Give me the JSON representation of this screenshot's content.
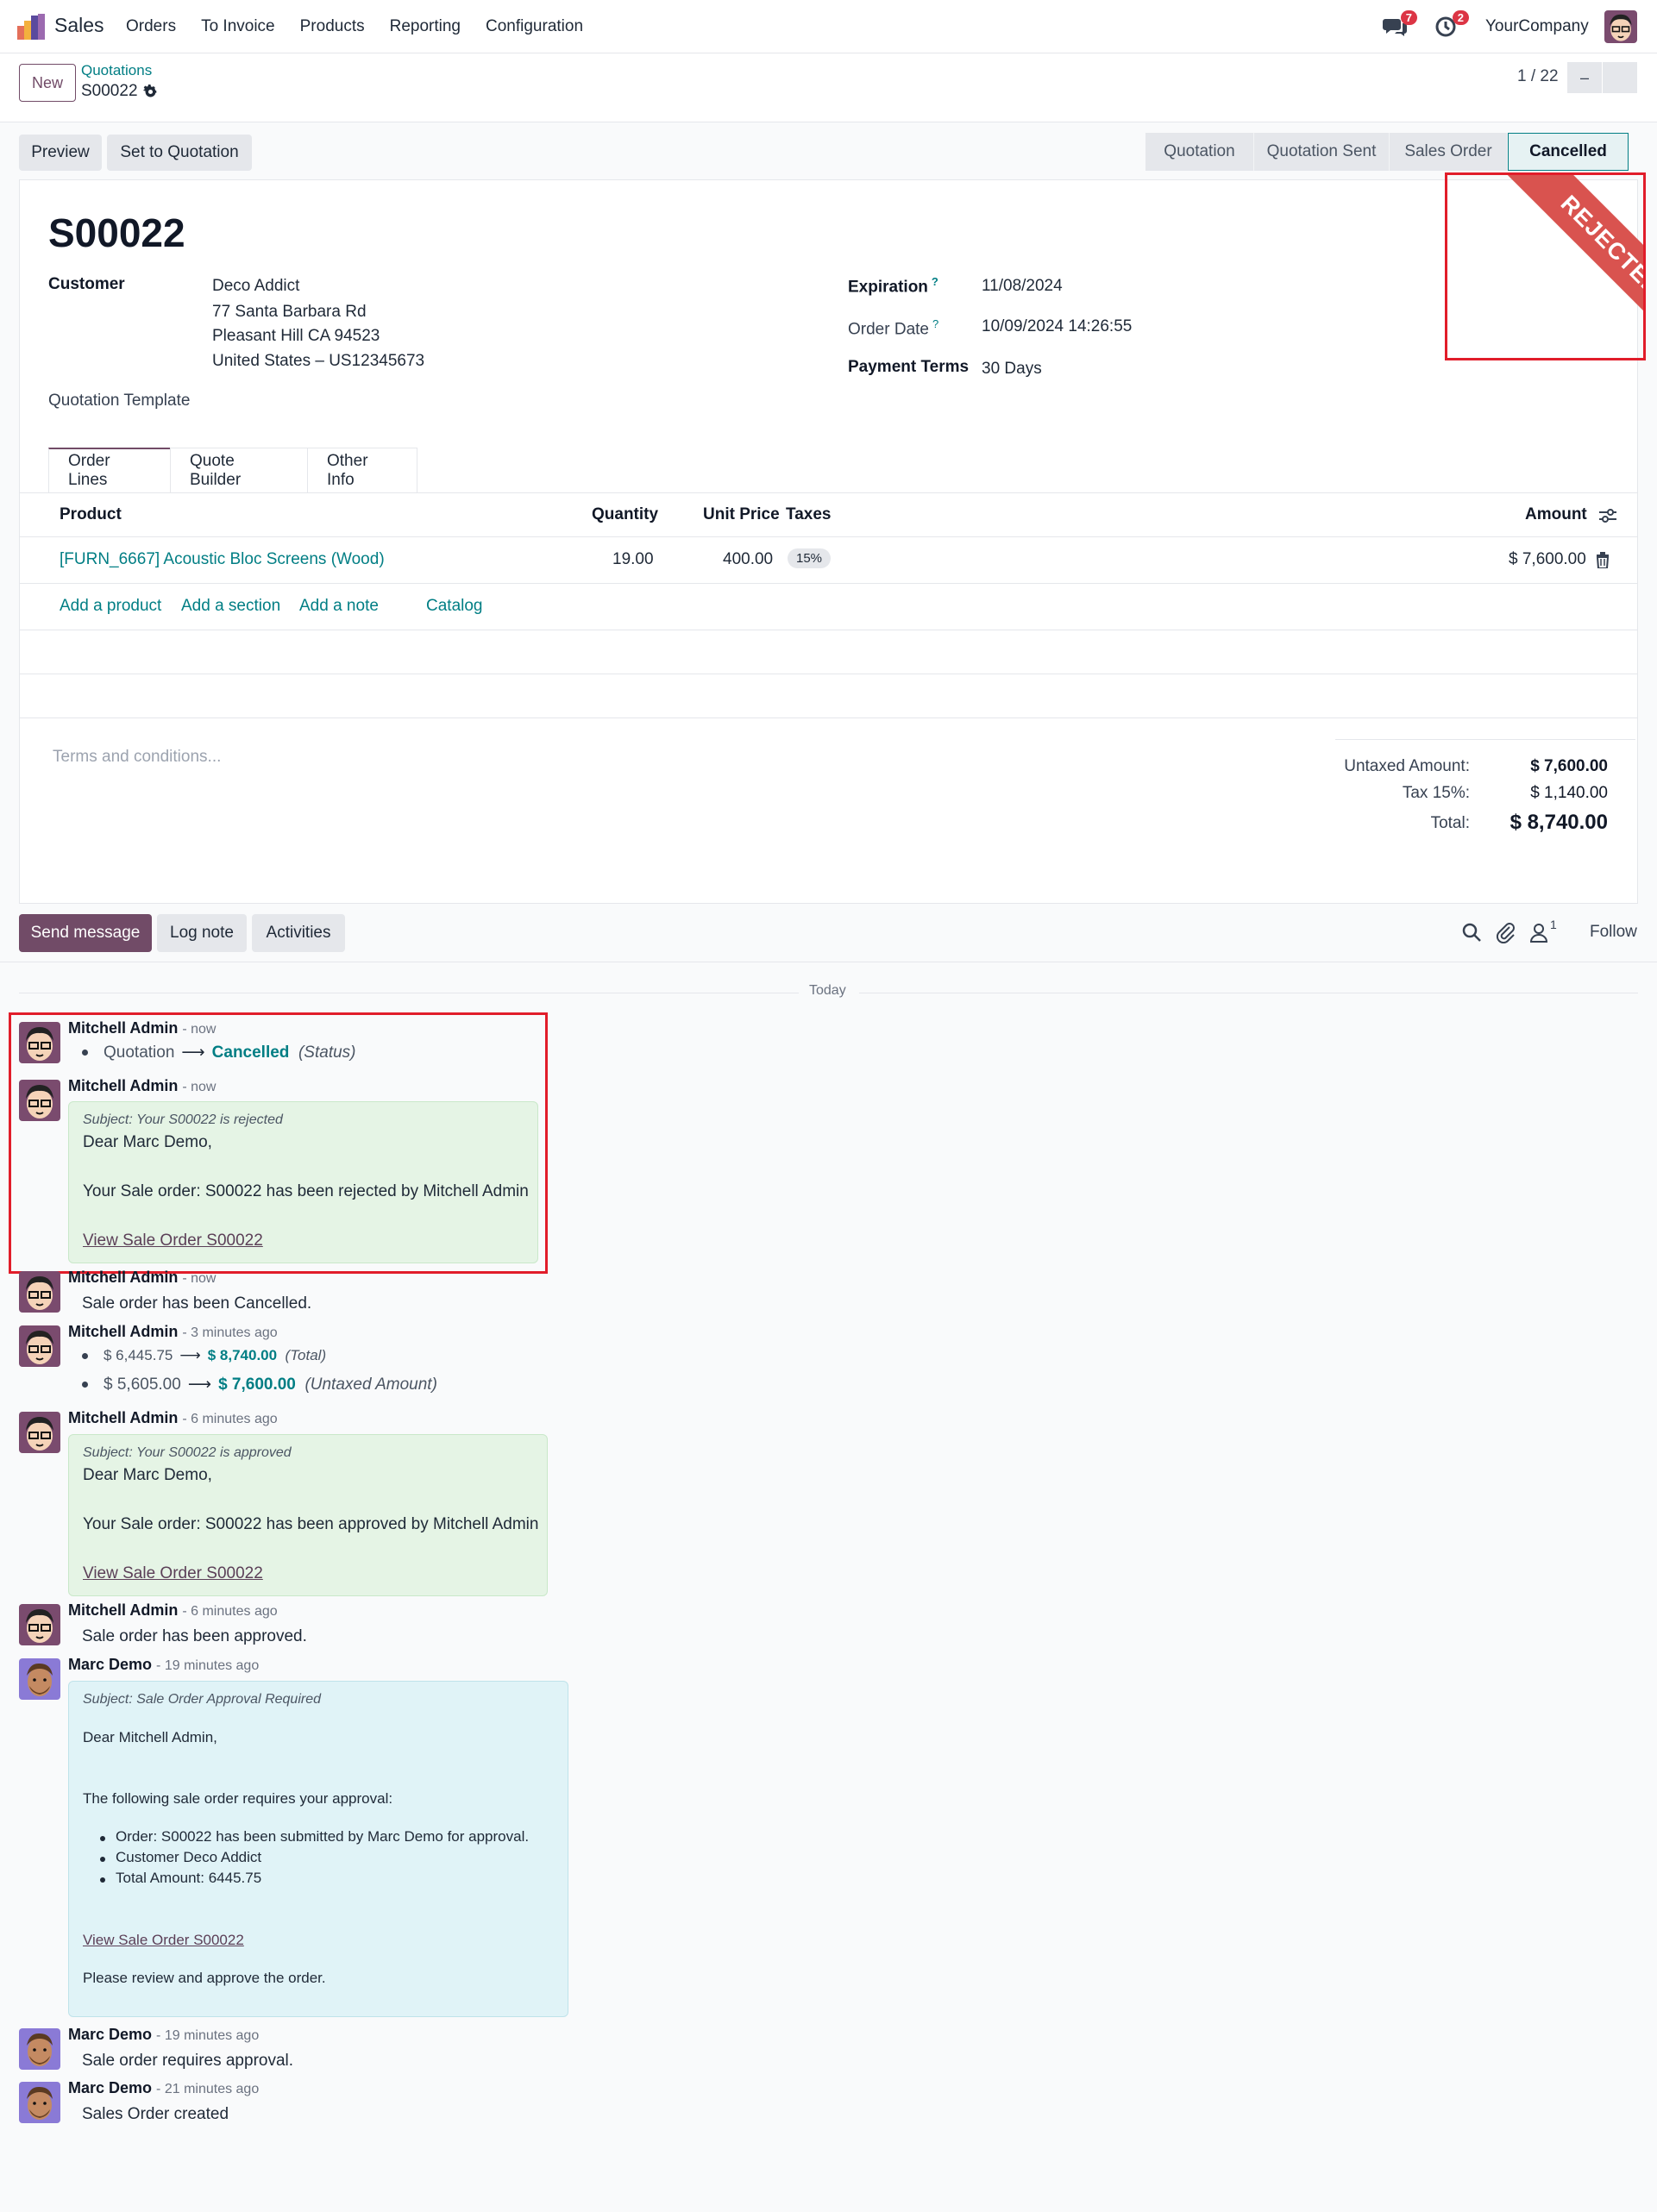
{
  "navbar": {
    "app_name": "Sales",
    "menu": [
      "Orders",
      "To Invoice",
      "Products",
      "Reporting",
      "Configuration"
    ],
    "messages_badge": "7",
    "activities_badge": "2",
    "company": "YourCompany"
  },
  "control": {
    "new_label": "New",
    "breadcrumb_parent": "Quotations",
    "breadcrumb_current": "S00022",
    "pager": "1 / 22"
  },
  "actions": {
    "preview": "Preview",
    "set_to_quotation": "Set to Quotation"
  },
  "statusbar": {
    "steps": [
      "Quotation",
      "Quotation Sent",
      "Sales Order",
      "Cancelled"
    ],
    "active": "Cancelled"
  },
  "form": {
    "name": "S00022",
    "ribbon": "REJECTED",
    "customer_label": "Customer",
    "customer_name": "Deco Addict",
    "address_line1": "77 Santa Barbara Rd",
    "address_line2": "Pleasant Hill CA 94523",
    "address_line3": "United States – US12345673",
    "quotation_template_label": "Quotation Template",
    "expiration_label": "Expiration",
    "expiration_value": "11/08/2024",
    "order_date_label": "Order Date",
    "order_date_value": "10/09/2024 14:26:55",
    "payment_terms_label": "Payment Terms",
    "payment_terms_value": "30 Days",
    "help_mark": "?"
  },
  "tabs": [
    "Order Lines",
    "Quote Builder",
    "Other Info"
  ],
  "order_lines": {
    "headers": {
      "product": "Product",
      "quantity": "Quantity",
      "unit_price": "Unit Price",
      "taxes": "Taxes",
      "amount": "Amount"
    },
    "rows": [
      {
        "product": "[FURN_6667] Acoustic Bloc Screens (Wood)",
        "quantity": "19.00",
        "unit_price": "400.00",
        "tax": "15%",
        "amount": "$ 7,600.00"
      }
    ],
    "add_product": "Add a product",
    "add_section": "Add a section",
    "add_note": "Add a note",
    "catalog": "Catalog"
  },
  "terms_placeholder": "Terms and conditions...",
  "totals": {
    "untaxed_label": "Untaxed Amount:",
    "untaxed_value": "$ 7,600.00",
    "tax_label": "Tax 15%:",
    "tax_value": "$ 1,140.00",
    "total_label": "Total:",
    "total_value": "$ 8,740.00"
  },
  "chatter": {
    "send_message": "Send message",
    "log_note": "Log note",
    "activities": "Activities",
    "followers_count": "1",
    "follow": "Follow",
    "today": "Today",
    "messages": [
      {
        "author": "Mitchell Admin",
        "time": "- now",
        "old": "Quotation",
        "new": "Cancelled",
        "field": "(Status)"
      },
      {
        "author": "Mitchell Admin",
        "time": "- now",
        "subject": "Subject: Your S00022 is rejected",
        "greeting": "Dear Marc Demo,",
        "body": "Your Sale order: S00022 has been rejected by Mitchell Admin",
        "link": "View Sale Order S00022"
      },
      {
        "author": "Mitchell Admin",
        "time": "- now",
        "body": "Sale order has been Cancelled."
      },
      {
        "author": "Mitchell Admin",
        "time": "- 3 minutes ago",
        "old1": "$ 6,445.75",
        "new1": "$ 8,740.00",
        "field1": "(Total)",
        "old2": "$ 5,605.00",
        "new2": "$ 7,600.00",
        "field2": "(Untaxed Amount)"
      },
      {
        "author": "Mitchell Admin",
        "time": "- 6 minutes ago",
        "subject": "Subject: Your S00022 is approved",
        "greeting": "Dear Marc Demo,",
        "body": "Your Sale order: S00022 has been approved by Mitchell Admin",
        "link": "View Sale Order S00022"
      },
      {
        "author": "Mitchell Admin",
        "time": "- 6 minutes ago",
        "body": "Sale order has been approved."
      },
      {
        "author": "Marc Demo",
        "time": "- 19 minutes ago",
        "subject": "Subject: Sale Order Approval Required",
        "greeting": "Dear Mitchell Admin,",
        "intro": "The following sale order requires your approval:",
        "items": [
          "Order: S00022 has been submitted by Marc Demo for approval.",
          "Customer Deco Addict",
          "Total Amount: 6445.75"
        ],
        "link": "View Sale Order S00022",
        "closing": "Please review and approve the order."
      },
      {
        "author": "Marc Demo",
        "time": "- 19 minutes ago",
        "body": "Sale order requires approval."
      },
      {
        "author": "Marc Demo",
        "time": "- 21 minutes ago",
        "body": "Sales Order created"
      }
    ]
  },
  "colors": {
    "brand": "#714b67",
    "link": "#017e84",
    "ribbon": "#d9534f",
    "highlight": "#e11d2a"
  }
}
